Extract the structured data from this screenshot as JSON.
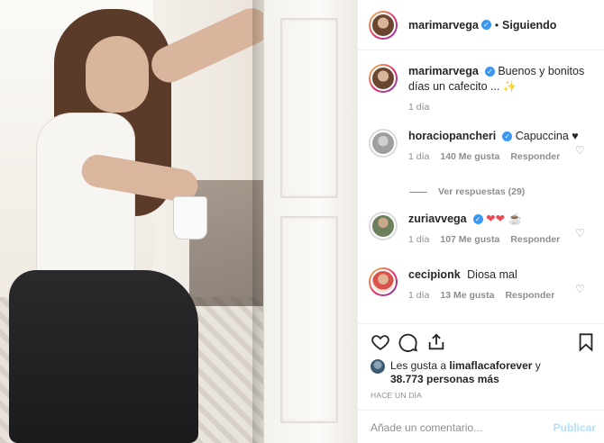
{
  "post": {
    "author": "marimarvega",
    "follow_status": "Siguiendo",
    "separator": "•"
  },
  "caption": {
    "username": "marimarvega",
    "text": "Buenos y bonitos días un cafecito ... ✨",
    "time": "1 día"
  },
  "comments": [
    {
      "username": "horaciopancheri",
      "text": "Capuccina ♥",
      "time": "1 día",
      "likes": "140 Me gusta",
      "reply": "Responder",
      "verified": true
    },
    {
      "username": "zuriavvega",
      "text": "❤❤ ☕",
      "time": "1 día",
      "likes": "107 Me gusta",
      "reply": "Responder",
      "verified": true
    },
    {
      "username": "cecipionk",
      "text": "Diosa mal",
      "time": "1 día",
      "likes": "13 Me gusta",
      "reply": "Responder",
      "verified": false
    }
  ],
  "view_replies": "Ver respuestas (29)",
  "likes": {
    "prefix": "Les gusta a",
    "user": "limaflacaforever",
    "conj": "y",
    "others": "38.773 personas más"
  },
  "timestamp": "HACE UN DÍA",
  "comment_box": {
    "placeholder": "Añade un comentario...",
    "publish": "Publicar"
  },
  "icons": [
    "heart-icon",
    "comment-icon",
    "share-icon",
    "bookmark-icon"
  ],
  "colors": {
    "verified": "#3897f0",
    "muted": "#8e8e8e",
    "publish_disabled": "#b2dffc",
    "like_red": "#ed4956"
  }
}
